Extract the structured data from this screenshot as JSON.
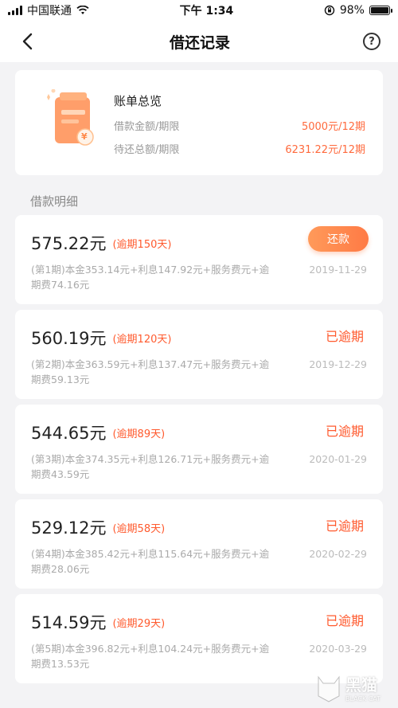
{
  "status_bar": {
    "carrier": "中国联通",
    "time": "下午 1:34",
    "battery_pct": "98%",
    "battery_level": 0.98
  },
  "nav": {
    "title": "借还记录",
    "back_icon": "chevron-left-icon",
    "help_icon": "question-circle-icon",
    "help_glyph": "?"
  },
  "summary": {
    "title": "账单总览",
    "rows": [
      {
        "label": "借款金额/期限",
        "value": "5000元/12期"
      },
      {
        "label": "待还总额/期限",
        "value": "6231.22元/12期"
      }
    ],
    "illustration": "bill-folder-icon",
    "coin_glyph": "¥"
  },
  "section_label": "借款明细",
  "loans": [
    {
      "amount": "575.22元",
      "overdue": "(逾期150天)",
      "detail": "(第1期)本金353.14元+利息147.92元+服务费元+逾期费74.16元",
      "date": "2019-11-29",
      "action": "还款"
    },
    {
      "amount": "560.19元",
      "overdue": "(逾期120天)",
      "detail": "(第2期)本金363.59元+利息137.47元+服务费元+逾期费59.13元",
      "date": "2019-12-29",
      "status": "已逾期"
    },
    {
      "amount": "544.65元",
      "overdue": "(逾期89天)",
      "detail": "(第3期)本金374.35元+利息126.71元+服务费元+逾期费43.59元",
      "date": "2020-01-29",
      "status": "已逾期"
    },
    {
      "amount": "529.12元",
      "overdue": "(逾期58天)",
      "detail": "(第4期)本金385.42元+利息115.64元+服务费元+逾期费28.06元",
      "date": "2020-02-29",
      "status": "已逾期"
    },
    {
      "amount": "514.59元",
      "overdue": "(逾期29天)",
      "detail": "(第5期)本金396.82元+利息104.24元+服务费元+逾期费13.53元",
      "date": "2020-03-29",
      "status": "已逾期"
    }
  ],
  "watermark": {
    "main": "黑猫",
    "sub": "BLACK CAT"
  },
  "colors": {
    "accent": "#ff5a2e",
    "button_start": "#ff9a5a",
    "button_end": "#ff7a45",
    "background": "#f3f3f5"
  }
}
